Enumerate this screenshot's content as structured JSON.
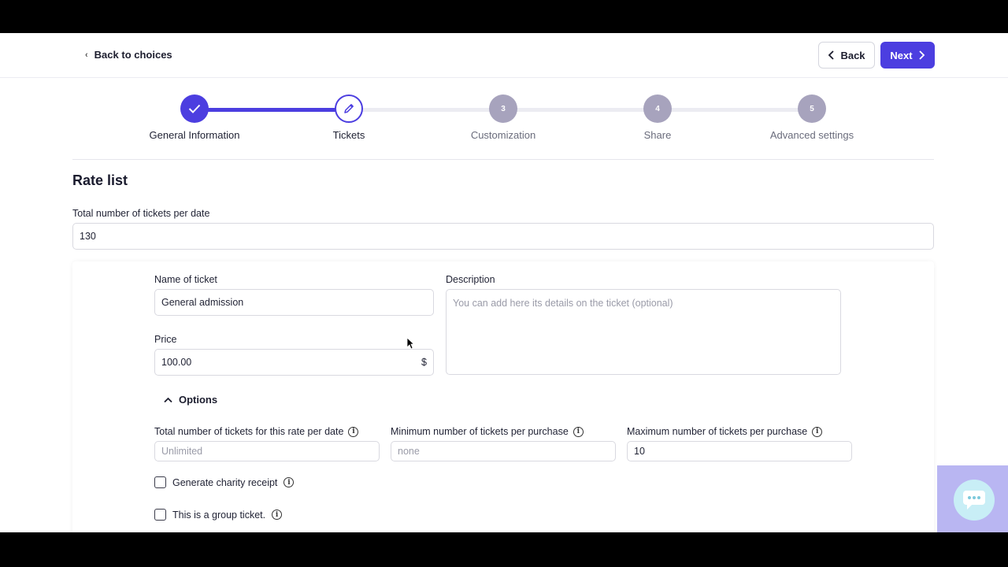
{
  "header": {
    "back_to_choices": "Back to choices",
    "back_label": "Back",
    "next_label": "Next"
  },
  "stepper": {
    "steps": [
      {
        "number": "",
        "label": "General Information",
        "state": "done"
      },
      {
        "number": "",
        "label": "Tickets",
        "state": "active"
      },
      {
        "number": "3",
        "label": "Customization",
        "state": "todo"
      },
      {
        "number": "4",
        "label": "Share",
        "state": "todo"
      },
      {
        "number": "5",
        "label": "Advanced settings",
        "state": "todo"
      }
    ]
  },
  "main": {
    "title": "Rate list",
    "total_tickets_label": "Total number of tickets per date",
    "total_tickets_value": "130",
    "ticket": {
      "name_label": "Name of ticket",
      "name_value": "General admission",
      "description_label": "Description",
      "description_placeholder": "You can add here its details on the ticket (optional)",
      "price_label": "Price",
      "price_value": "100.00",
      "currency": "$",
      "options_label": "Options",
      "rate_total_label": "Total number of tickets for this rate per date",
      "rate_total_placeholder": "Unlimited",
      "min_label": "Minimum number of tickets per purchase",
      "min_placeholder": "none",
      "max_label": "Maximum number of tickets per purchase",
      "max_value": "10",
      "charity_label": "Generate charity receipt",
      "group_label": "This is a group ticket."
    }
  },
  "colors": {
    "accent": "#4c3ee0",
    "step_inactive": "#a7a3bd",
    "chat_bg": "#b9b6f2"
  },
  "icons": {
    "chat": "chat-bubble-icon",
    "info": "info-icon",
    "check": "check-icon",
    "pencil": "pencil-icon"
  }
}
